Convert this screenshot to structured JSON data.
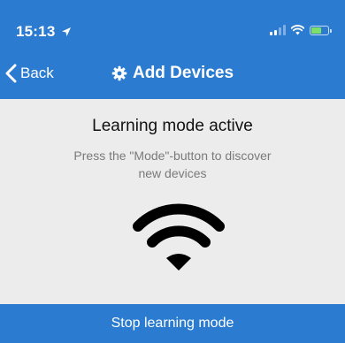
{
  "status_bar": {
    "time": "15:13",
    "location_icon": "location-arrow-icon",
    "signal_icon": "cellular-signal-icon",
    "wifi_icon": "wifi-status-icon",
    "battery_icon": "battery-icon",
    "battery_color": "#7ee06b"
  },
  "nav": {
    "back_label": "Back",
    "back_icon": "chevron-left-icon",
    "title_icon": "gear-icon",
    "title": "Add Devices"
  },
  "main": {
    "title": "Learning mode active",
    "subtitle": "Press the \"Mode\"-button to discover new devices",
    "center_icon": "wifi-icon"
  },
  "footer": {
    "button_label": "Stop learning mode"
  },
  "colors": {
    "header_bg": "#2b7bd0",
    "content_bg": "#ececec",
    "footer_bg": "#2b7bd0"
  }
}
